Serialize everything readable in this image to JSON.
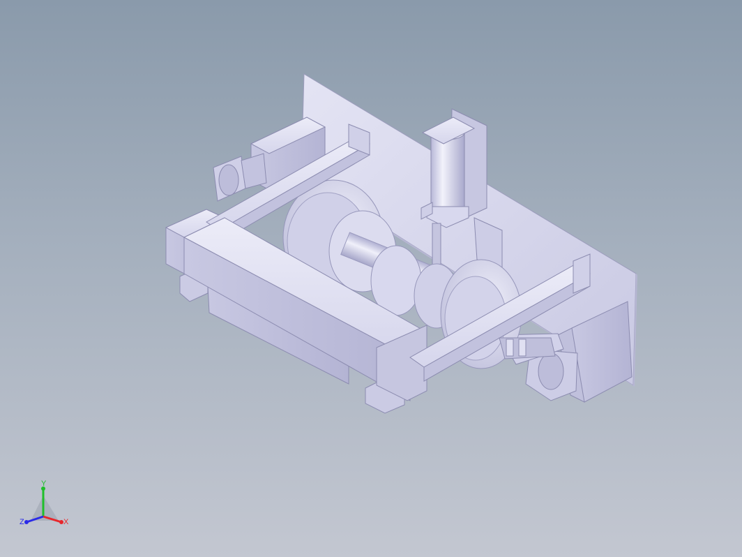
{
  "viewport": {
    "background_top": "#8a9aab",
    "background_bottom": "#c3c7d1"
  },
  "model": {
    "part_color": "#d9d9ee",
    "shade_color": "#b9b9d6",
    "dark_color": "#9a9ac0",
    "edge_color": "#6e6e8e"
  },
  "triad": {
    "x_label": "X",
    "y_label": "Y",
    "z_label": "Z",
    "x_color": "#e8262b",
    "y_color": "#1fbf2a",
    "z_color": "#2a2ae8"
  }
}
